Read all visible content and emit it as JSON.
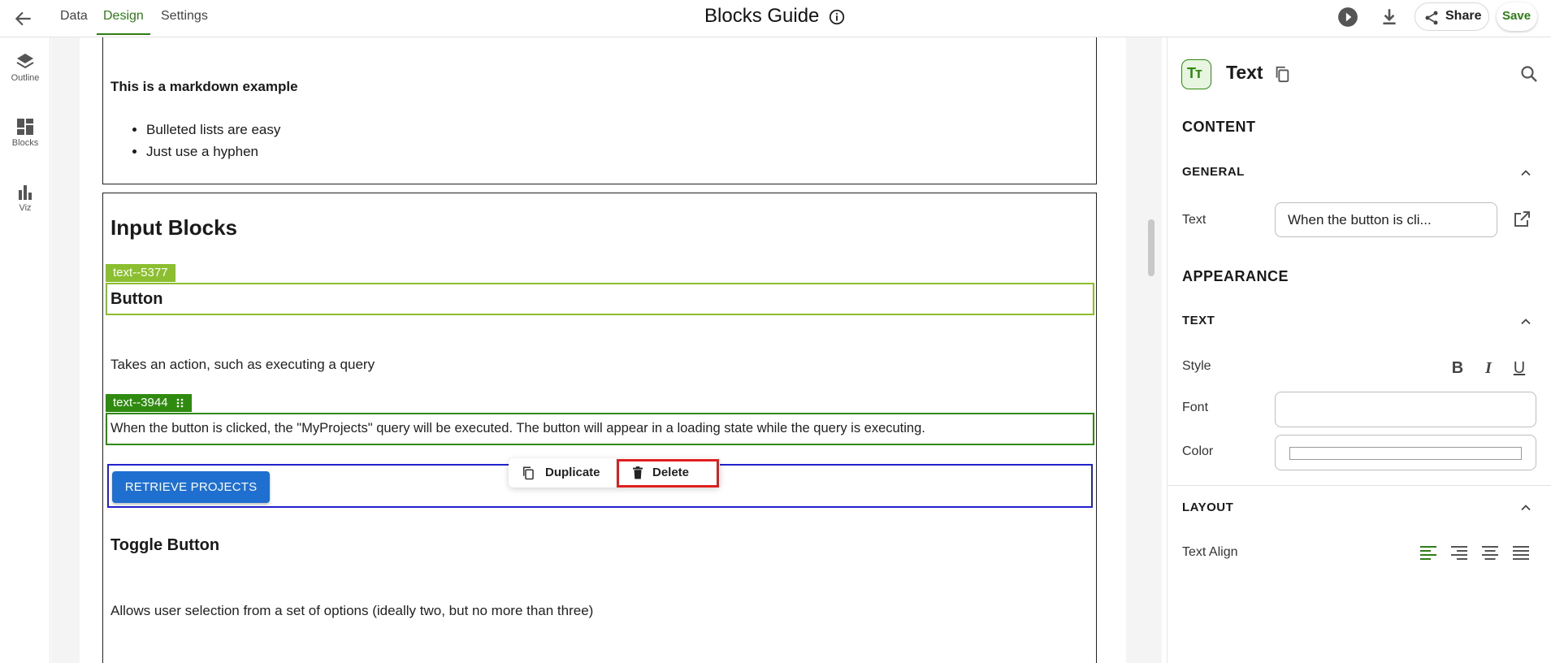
{
  "topbar": {
    "tabs": [
      {
        "label": "Data"
      },
      {
        "label": "Design"
      },
      {
        "label": "Settings"
      }
    ],
    "title": "Blocks Guide",
    "share_label": "Share",
    "save_label": "Save"
  },
  "rail": {
    "items": [
      {
        "label": "Outline",
        "icon": "layers-icon"
      },
      {
        "label": "Blocks",
        "icon": "grid-icon"
      },
      {
        "label": "Viz",
        "icon": "bar-chart-icon"
      }
    ]
  },
  "canvas": {
    "markdown": {
      "heading": "This is a markdown example",
      "bullets": [
        "Bulleted lists are easy",
        "Just use a hyphen"
      ]
    },
    "input_blocks": {
      "heading": "Input Blocks",
      "tag_button_heading": "text--5377",
      "button_heading": "Button",
      "button_desc": "Takes an action, such as executing a query",
      "tag_button_note": "text--3944",
      "button_note": "When the button is clicked, the \"MyProjects\" query will be executed. The button will appear in a loading state while the query is executing.",
      "retrieve_label": "RETRIEVE PROJECTS",
      "popover": {
        "duplicate_label": "Duplicate",
        "delete_label": "Delete"
      },
      "toggle_heading": "Toggle Button",
      "toggle_desc": "Allows user selection from a set of options (ideally two, but no more than three)"
    }
  },
  "panel": {
    "icon_text": "Tт",
    "title": "Text",
    "content_title": "CONTENT",
    "general_title": "GENERAL",
    "text_label": "Text",
    "text_value": "When the button is cli...",
    "appearance_title": "APPEARANCE",
    "text_section_title": "TEXT",
    "style_label": "Style",
    "font_label": "Font",
    "color_label": "Color",
    "layout_title": "LAYOUT",
    "align_label": "Text Align",
    "style_buttons": {
      "bold": "B",
      "italic": "I",
      "underline": "U"
    }
  },
  "colors": {
    "accent_green": "#2e7d16",
    "tag_light": "#8bbf2f",
    "tag_dark": "#2e8b10",
    "button_blue": "#1f6fd1",
    "delete_highlight": "#e01e1e"
  }
}
